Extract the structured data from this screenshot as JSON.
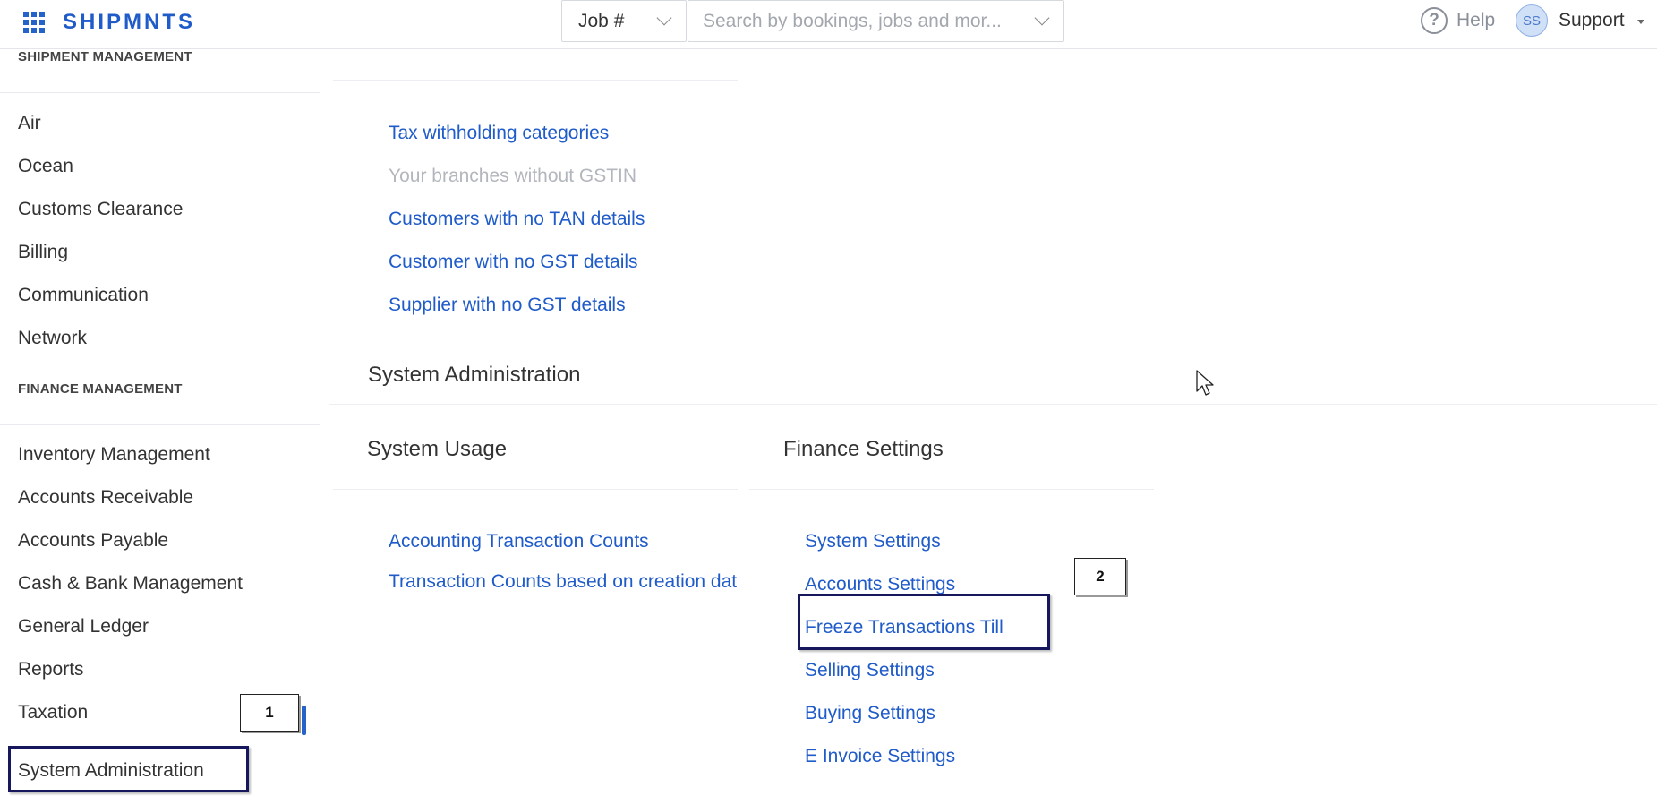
{
  "topbar": {
    "brand": "SHIPMNTS",
    "job_select_label": "Job #",
    "search_placeholder": "Search by bookings, jobs and mor...",
    "help_label": "Help",
    "user_initials": "SS",
    "user_name": "Support"
  },
  "sidebar": {
    "shipment_heading": "SHIPMENT MANAGEMENT",
    "shipment_items": [
      "Air",
      "Ocean",
      "Customs Clearance",
      "Billing",
      "Communication",
      "Network"
    ],
    "finance_heading": "FINANCE MANAGEMENT",
    "finance_items": [
      "Inventory Management",
      "Accounts Receivable",
      "Accounts Payable",
      "Cash & Bank Management",
      "General Ledger",
      "Reports",
      "Taxation"
    ],
    "active_item": "System Administration"
  },
  "main": {
    "tax_links": [
      {
        "label": "Tax withholding categories",
        "enabled": true
      },
      {
        "label": "Your branches without GSTIN",
        "enabled": false
      },
      {
        "label": "Customers with no TAN details",
        "enabled": true
      },
      {
        "label": "Customer with no GST details",
        "enabled": true
      },
      {
        "label": "Supplier with no GST details",
        "enabled": true
      }
    ],
    "section_title": "System Administration",
    "system_usage": {
      "title": "System Usage",
      "links": [
        "Accounting Transaction Counts",
        "Transaction Counts based on creation date"
      ]
    },
    "finance_settings": {
      "title": "Finance Settings",
      "links": [
        "System Settings",
        "Accounts Settings",
        "Freeze Transactions Till",
        "Selling Settings",
        "Buying Settings",
        "E Invoice Settings"
      ]
    }
  },
  "annotations": {
    "marker_1": "1",
    "marker_2": "2"
  },
  "colors": {
    "brand": "#1f5bc9",
    "link": "#1f5bc9",
    "disabled_link": "#b3b7bd",
    "highlight_box": "#17175e",
    "active_indicator": "#2563c9"
  }
}
